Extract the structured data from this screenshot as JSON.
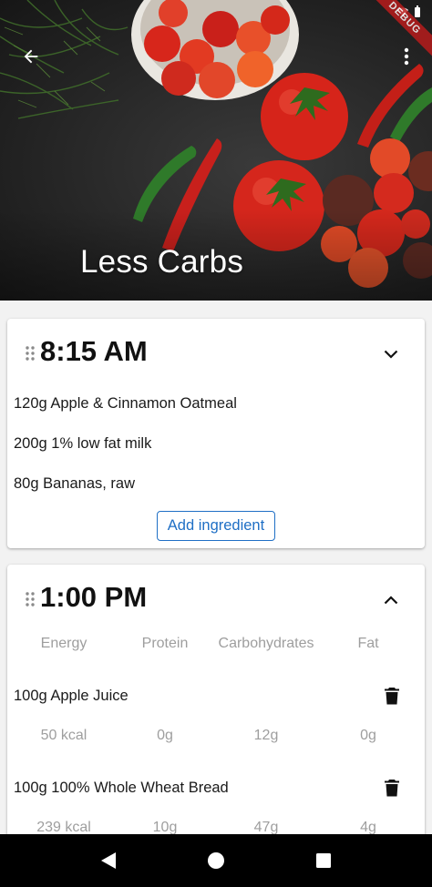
{
  "header": {
    "title": "Less Carbs",
    "back_icon": "arrow-back-icon",
    "more_icon": "more-vert-icon",
    "debug_label": "DEBUG"
  },
  "meals": [
    {
      "time": "8:15 AM",
      "expanded": false,
      "ingredients": [
        "120g Apple & Cinnamon Oatmeal",
        "200g 1% low fat milk",
        "80g Bananas, raw"
      ],
      "add_button_label": "Add ingredient"
    },
    {
      "time": "1:00 PM",
      "expanded": true,
      "columns": [
        "Energy",
        "Protein",
        "Carbohydrates",
        "Fat"
      ],
      "ingredients": [
        {
          "name": "100g Apple Juice",
          "energy": "50 kcal",
          "protein": "0g",
          "carbs": "12g",
          "fat": "0g"
        },
        {
          "name": "100g 100% Whole Wheat Bread",
          "energy": "239 kcal",
          "protein": "10g",
          "carbs": "47g",
          "fat": "4g"
        }
      ]
    }
  ],
  "colors": {
    "accent": "#1f6fc5",
    "muted_text": "#9e9e9e",
    "card_bg": "#ffffff",
    "page_bg": "#f2f2f2",
    "nav_bg": "#000000"
  },
  "navbar": {
    "back_icon": "nav-back-triangle-icon",
    "home_icon": "nav-home-circle-icon",
    "recents_icon": "nav-recents-square-icon"
  }
}
